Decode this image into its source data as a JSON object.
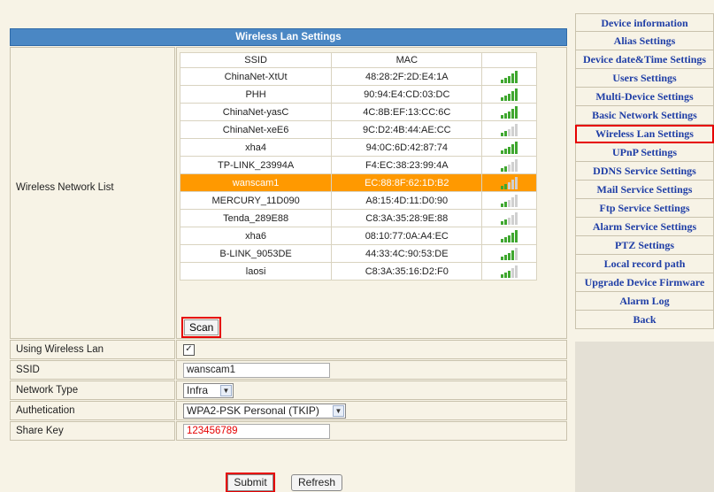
{
  "panel_title": "Wireless Lan Settings",
  "network_list": {
    "label": "Wireless Network List",
    "columns": [
      "SSID",
      "MAC"
    ],
    "networks": [
      {
        "ssid": "ChinaNet-XtUt",
        "mac": "48:28:2F:2D:E4:1A",
        "signal": 5
      },
      {
        "ssid": "PHH",
        "mac": "90:94:E4:CD:03:DC",
        "signal": 5
      },
      {
        "ssid": "ChinaNet-yasC",
        "mac": "4C:8B:EF:13:CC:6C",
        "signal": 5
      },
      {
        "ssid": "ChinaNet-xeE6",
        "mac": "9C:D2:4B:44:AE:CC",
        "signal": 2
      },
      {
        "ssid": "xha4",
        "mac": "94:0C:6D:42:87:74",
        "signal": 5
      },
      {
        "ssid": "TP-LINK_23994A",
        "mac": "F4:EC:38:23:99:4A",
        "signal": 2
      },
      {
        "ssid": "wanscam1",
        "mac": "EC:88:8F:62:1D:B2",
        "signal": 2,
        "selected": true
      },
      {
        "ssid": "MERCURY_11D090",
        "mac": "A8:15:4D:11:D0:90",
        "signal": 2
      },
      {
        "ssid": "Tenda_289E88",
        "mac": "C8:3A:35:28:9E:88",
        "signal": 2
      },
      {
        "ssid": "xha6",
        "mac": "08:10:77:0A:A4:EC",
        "signal": 5
      },
      {
        "ssid": "B-LINK_9053DE",
        "mac": "44:33:4C:90:53:DE",
        "signal": 4
      },
      {
        "ssid": "laosi",
        "mac": "C8:3A:35:16:D2:F0",
        "signal": 3
      }
    ],
    "scan_label": "Scan"
  },
  "form": {
    "using_wireless": {
      "label": "Using Wireless Lan",
      "checked": true,
      "check_glyph": "✓"
    },
    "ssid": {
      "label": "SSID",
      "value": "wanscam1"
    },
    "network_type": {
      "label": "Network Type",
      "value": "Infra"
    },
    "authentication": {
      "label": "Authetication",
      "value": "WPA2-PSK Personal (TKIP)"
    },
    "share_key": {
      "label": "Share Key",
      "value": "123456789"
    }
  },
  "buttons": {
    "submit": "Submit",
    "refresh": "Refresh"
  },
  "sidebar": {
    "items": [
      {
        "label": "Device information"
      },
      {
        "label": "Alias Settings"
      },
      {
        "label": "Device date&Time Settings"
      },
      {
        "label": "Users Settings"
      },
      {
        "label": "Multi-Device Settings"
      },
      {
        "label": "Basic Network Settings"
      },
      {
        "label": "Wireless Lan Settings",
        "active": true
      },
      {
        "label": "UPnP Settings"
      },
      {
        "label": "DDNS Service Settings"
      },
      {
        "label": "Mail Service Settings"
      },
      {
        "label": "Ftp Service Settings"
      },
      {
        "label": "Alarm Service Settings"
      },
      {
        "label": "PTZ Settings"
      },
      {
        "label": "Local record path"
      },
      {
        "label": "Upgrade Device Firmware"
      },
      {
        "label": "Alarm Log"
      },
      {
        "label": "Back"
      }
    ]
  },
  "colors": {
    "header": "#4a87c4",
    "selected_row": "#ff9900",
    "signal_on": "#3fa72f",
    "highlight": "#e60000",
    "link": "#1f3ea6"
  }
}
